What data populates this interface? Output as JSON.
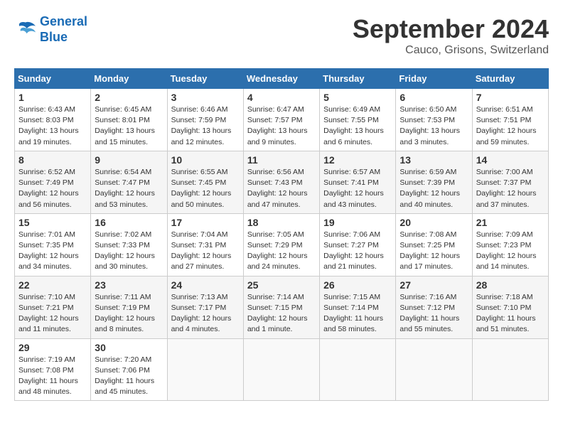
{
  "header": {
    "logo_line1": "General",
    "logo_line2": "Blue",
    "month": "September 2024",
    "location": "Cauco, Grisons, Switzerland"
  },
  "weekdays": [
    "Sunday",
    "Monday",
    "Tuesday",
    "Wednesday",
    "Thursday",
    "Friday",
    "Saturday"
  ],
  "weeks": [
    [
      {
        "day": "1",
        "detail": "Sunrise: 6:43 AM\nSunset: 8:03 PM\nDaylight: 13 hours\nand 19 minutes."
      },
      {
        "day": "2",
        "detail": "Sunrise: 6:45 AM\nSunset: 8:01 PM\nDaylight: 13 hours\nand 15 minutes."
      },
      {
        "day": "3",
        "detail": "Sunrise: 6:46 AM\nSunset: 7:59 PM\nDaylight: 13 hours\nand 12 minutes."
      },
      {
        "day": "4",
        "detail": "Sunrise: 6:47 AM\nSunset: 7:57 PM\nDaylight: 13 hours\nand 9 minutes."
      },
      {
        "day": "5",
        "detail": "Sunrise: 6:49 AM\nSunset: 7:55 PM\nDaylight: 13 hours\nand 6 minutes."
      },
      {
        "day": "6",
        "detail": "Sunrise: 6:50 AM\nSunset: 7:53 PM\nDaylight: 13 hours\nand 3 minutes."
      },
      {
        "day": "7",
        "detail": "Sunrise: 6:51 AM\nSunset: 7:51 PM\nDaylight: 12 hours\nand 59 minutes."
      }
    ],
    [
      {
        "day": "8",
        "detail": "Sunrise: 6:52 AM\nSunset: 7:49 PM\nDaylight: 12 hours\nand 56 minutes."
      },
      {
        "day": "9",
        "detail": "Sunrise: 6:54 AM\nSunset: 7:47 PM\nDaylight: 12 hours\nand 53 minutes."
      },
      {
        "day": "10",
        "detail": "Sunrise: 6:55 AM\nSunset: 7:45 PM\nDaylight: 12 hours\nand 50 minutes."
      },
      {
        "day": "11",
        "detail": "Sunrise: 6:56 AM\nSunset: 7:43 PM\nDaylight: 12 hours\nand 47 minutes."
      },
      {
        "day": "12",
        "detail": "Sunrise: 6:57 AM\nSunset: 7:41 PM\nDaylight: 12 hours\nand 43 minutes."
      },
      {
        "day": "13",
        "detail": "Sunrise: 6:59 AM\nSunset: 7:39 PM\nDaylight: 12 hours\nand 40 minutes."
      },
      {
        "day": "14",
        "detail": "Sunrise: 7:00 AM\nSunset: 7:37 PM\nDaylight: 12 hours\nand 37 minutes."
      }
    ],
    [
      {
        "day": "15",
        "detail": "Sunrise: 7:01 AM\nSunset: 7:35 PM\nDaylight: 12 hours\nand 34 minutes."
      },
      {
        "day": "16",
        "detail": "Sunrise: 7:02 AM\nSunset: 7:33 PM\nDaylight: 12 hours\nand 30 minutes."
      },
      {
        "day": "17",
        "detail": "Sunrise: 7:04 AM\nSunset: 7:31 PM\nDaylight: 12 hours\nand 27 minutes."
      },
      {
        "day": "18",
        "detail": "Sunrise: 7:05 AM\nSunset: 7:29 PM\nDaylight: 12 hours\nand 24 minutes."
      },
      {
        "day": "19",
        "detail": "Sunrise: 7:06 AM\nSunset: 7:27 PM\nDaylight: 12 hours\nand 21 minutes."
      },
      {
        "day": "20",
        "detail": "Sunrise: 7:08 AM\nSunset: 7:25 PM\nDaylight: 12 hours\nand 17 minutes."
      },
      {
        "day": "21",
        "detail": "Sunrise: 7:09 AM\nSunset: 7:23 PM\nDaylight: 12 hours\nand 14 minutes."
      }
    ],
    [
      {
        "day": "22",
        "detail": "Sunrise: 7:10 AM\nSunset: 7:21 PM\nDaylight: 12 hours\nand 11 minutes."
      },
      {
        "day": "23",
        "detail": "Sunrise: 7:11 AM\nSunset: 7:19 PM\nDaylight: 12 hours\nand 8 minutes."
      },
      {
        "day": "24",
        "detail": "Sunrise: 7:13 AM\nSunset: 7:17 PM\nDaylight: 12 hours\nand 4 minutes."
      },
      {
        "day": "25",
        "detail": "Sunrise: 7:14 AM\nSunset: 7:15 PM\nDaylight: 12 hours\nand 1 minute."
      },
      {
        "day": "26",
        "detail": "Sunrise: 7:15 AM\nSunset: 7:14 PM\nDaylight: 11 hours\nand 58 minutes."
      },
      {
        "day": "27",
        "detail": "Sunrise: 7:16 AM\nSunset: 7:12 PM\nDaylight: 11 hours\nand 55 minutes."
      },
      {
        "day": "28",
        "detail": "Sunrise: 7:18 AM\nSunset: 7:10 PM\nDaylight: 11 hours\nand 51 minutes."
      }
    ],
    [
      {
        "day": "29",
        "detail": "Sunrise: 7:19 AM\nSunset: 7:08 PM\nDaylight: 11 hours\nand 48 minutes."
      },
      {
        "day": "30",
        "detail": "Sunrise: 7:20 AM\nSunset: 7:06 PM\nDaylight: 11 hours\nand 45 minutes."
      },
      {
        "day": "",
        "detail": ""
      },
      {
        "day": "",
        "detail": ""
      },
      {
        "day": "",
        "detail": ""
      },
      {
        "day": "",
        "detail": ""
      },
      {
        "day": "",
        "detail": ""
      }
    ]
  ]
}
